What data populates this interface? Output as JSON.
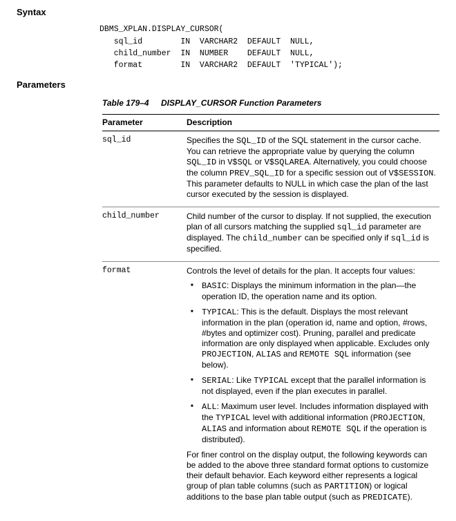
{
  "sections": {
    "syntax": "Syntax",
    "parameters": "Parameters"
  },
  "code": "DBMS_XPLAN.DISPLAY_CURSOR(\n   sql_id        IN  VARCHAR2  DEFAULT  NULL,\n   child_number  IN  NUMBER    DEFAULT  NULL,\n   format        IN  VARCHAR2  DEFAULT  'TYPICAL');",
  "table": {
    "number": "Table 179–4",
    "title": "DISPLAY_CURSOR Function Parameters",
    "headers": {
      "param": "Parameter",
      "desc": "Description"
    }
  },
  "rows": {
    "sql_id": {
      "name": "sql_id",
      "d1a": "Specifies the ",
      "d1b": "SQL_ID",
      "d1c": " of the SQL statement in the cursor cache. You can retrieve the appropriate value by querying the column ",
      "d1d": "SQL_ID",
      "d1e": " in ",
      "d1f": "V$SQL",
      "d1g": " or ",
      "d1h": "V$SQLAREA",
      "d1i": ". Alternatively, you could choose the column ",
      "d1j": "PREV_SQL_ID",
      "d1k": " for a specific session out of ",
      "d1l": "V$SESSION",
      "d1m": ". This parameter defaults to NULL in which case the plan of the last cursor executed by the session is displayed."
    },
    "child_number": {
      "name": "child_number",
      "d1a": "Child number of the cursor to display. If not supplied, the execution plan of all cursors matching the supplied ",
      "d1b": "sql_id",
      "d1c": " parameter are displayed. The ",
      "d1d": "child_number",
      "d1e": " can be specified only if ",
      "d1f": "sql_id",
      "d1g": " is specified."
    },
    "format": {
      "name": "format",
      "intro": "Controls the level of details for the plan. It accepts four values:",
      "b1a": "BASIC",
      "b1b": ": Displays the minimum information in the plan—the operation ID, the operation name and its option.",
      "b2a": "TYPICAL",
      "b2b": ": This is the default. Displays the most relevant information in the plan (operation id, name and option, #rows, #bytes and optimizer cost). Pruning, parallel and predicate information are only displayed when applicable. Excludes only ",
      "b2c": "PROJECTION",
      "b2d": ", ",
      "b2e": "ALIAS",
      "b2f": " and ",
      "b2g": "REMOTE SQL",
      "b2h": " information (see below).",
      "b3a": "SERIAL",
      "b3b": ": Like ",
      "b3c": "TYPICAL",
      "b3d": " except that the parallel information is not displayed, even if the plan executes in parallel.",
      "b4a": "ALL",
      "b4b": ": Maximum user level. Includes information displayed with the ",
      "b4c": "TYPICAL",
      "b4d": " level with additional information (",
      "b4e": "PROJECTION",
      "b4f": ", ",
      "b4g": "ALIAS",
      "b4h": " and information about ",
      "b4i": "REMOTE SQL",
      "b4j": " if the operation is distributed).",
      "outro_a": "For finer control on the display output, the following keywords can be added to the above three standard format options to customize their default behavior. Each keyword either represents a logical group of plan table columns (such as ",
      "outro_b": "PARTITION",
      "outro_c": ") or logical additions to the base plan table output (such as ",
      "outro_d": "PREDICATE",
      "outro_e": ")."
    }
  }
}
